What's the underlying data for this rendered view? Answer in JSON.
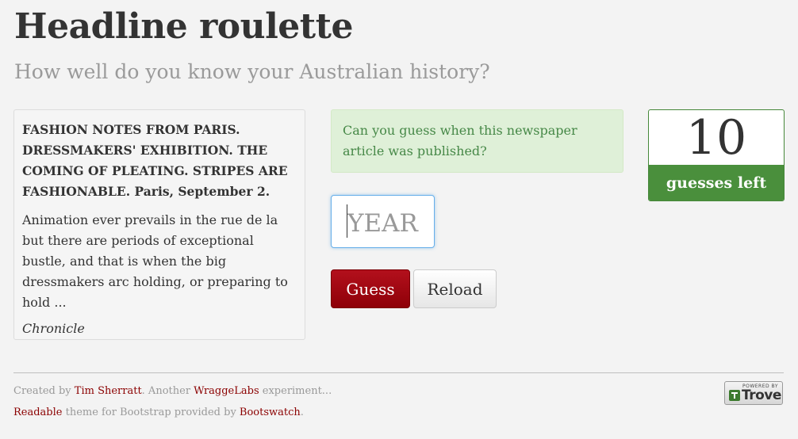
{
  "header": {
    "title": "Headline roulette",
    "subtitle": "How well do you know your Australian history?"
  },
  "article": {
    "title": "FASHION NOTES FROM PARIS. DRESSMAKERS' EXHIBITION. THE COMING OF PLEATING. STRIPES ARE FASHIONABLE. Paris, September 2.",
    "body": "Animation ever prevails in the rue de la but there are periods of exceptional bustle, and that is when the big dressmakers arc holding, or preparing to hold ...",
    "source": "Chronicle"
  },
  "prompt": {
    "text": "Can you guess when this newspaper article was published?"
  },
  "form": {
    "year_placeholder": "YEAR",
    "year_value": "",
    "guess_label": "Guess",
    "reload_label": "Reload"
  },
  "counter": {
    "value": "10",
    "label": "guesses left"
  },
  "footer": {
    "created_by_prefix": "Created by ",
    "author": "Tim Sherratt",
    "another": ". Another ",
    "lab": "WraggeLabs",
    "experiment": " experiment...",
    "theme": "Readable",
    "theme_text": " theme for Bootstrap provided by ",
    "provider": "Bootswatch",
    "end": "."
  },
  "badge": {
    "powered": "POWERED BY",
    "name": "Trove"
  },
  "colors": {
    "accent": "#8b0000",
    "success_bg": "#dff0d8",
    "success_text": "#468847",
    "counter_green": "#4a8f3c"
  }
}
